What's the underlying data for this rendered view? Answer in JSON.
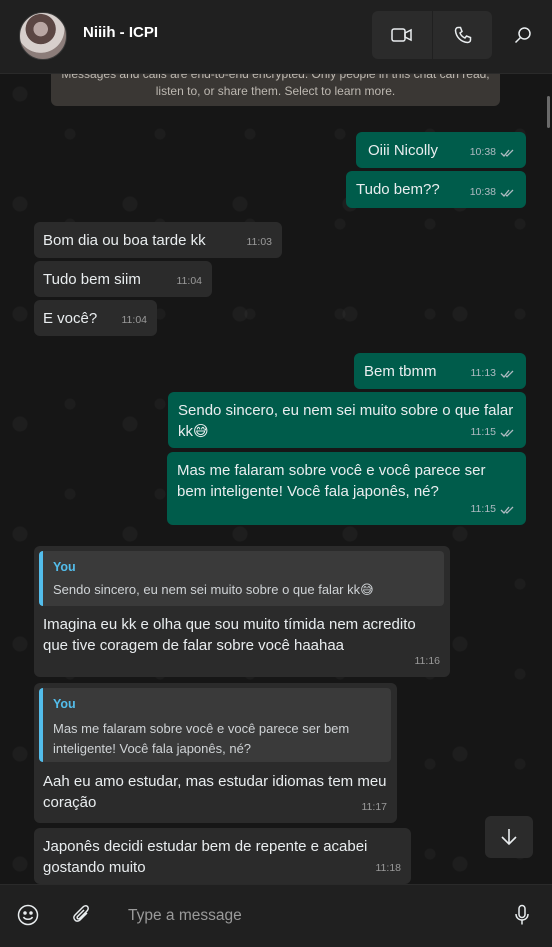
{
  "header": {
    "contact_name": "Niiih - ICPI",
    "video_icon": "video-camera-icon",
    "call_icon": "phone-icon",
    "search_icon": "search-icon"
  },
  "encryption_notice": "Messages and calls are end-to-end encrypted. Only people in this chat can read, listen to, or share them. Select to learn more.",
  "messages": [
    {
      "dir": "out",
      "text": "Oiii Nicolly",
      "time": "10:38"
    },
    {
      "dir": "out",
      "text": "Tudo bem??",
      "time": "10:38"
    },
    {
      "dir": "in",
      "text": "Bom dia ou boa tarde kk",
      "time": "11:03"
    },
    {
      "dir": "in",
      "text": "Tudo bem siim",
      "time": "11:04"
    },
    {
      "dir": "in",
      "text": "E você?",
      "time": "11:04"
    },
    {
      "dir": "out",
      "text": "Bem tbmm",
      "time": "11:13"
    },
    {
      "dir": "out",
      "text": "Sendo sincero, eu nem sei muito sobre o que falar kk😅",
      "time": "11:15"
    },
    {
      "dir": "out",
      "text": "Mas me falaram sobre você e você parece ser bem inteligente! Você fala japonês, né?",
      "time": "11:15"
    },
    {
      "dir": "in",
      "quote_author": "You",
      "quote_text": "Sendo sincero, eu nem sei muito sobre o que falar kk😅",
      "text": "Imagina eu kk e olha que sou muito tímida nem acredito que tive coragem de falar sobre você haahaa",
      "time": "11:16"
    },
    {
      "dir": "in",
      "quote_author": "You",
      "quote_text": "Mas me falaram sobre você e você parece ser bem inteligente! Você fala japonês, né?",
      "text": "Aah eu amo estudar, mas estudar idiomas tem meu coração",
      "time": "11:17"
    },
    {
      "dir": "in",
      "text": "Japonês decidi estudar bem de repente e acabei gostando muito",
      "time": "11:18"
    }
  ],
  "composer": {
    "placeholder": "Type a message",
    "emoji_icon": "emoji-icon",
    "attach_icon": "paperclip-icon",
    "mic_icon": "microphone-icon"
  },
  "scroll_down_icon": "chevron-down-icon",
  "colors": {
    "outgoing_bubble": "#005c4b",
    "incoming_bubble": "#2b2b2b",
    "quote_accent": "#53bdeb",
    "background": "#161616"
  }
}
